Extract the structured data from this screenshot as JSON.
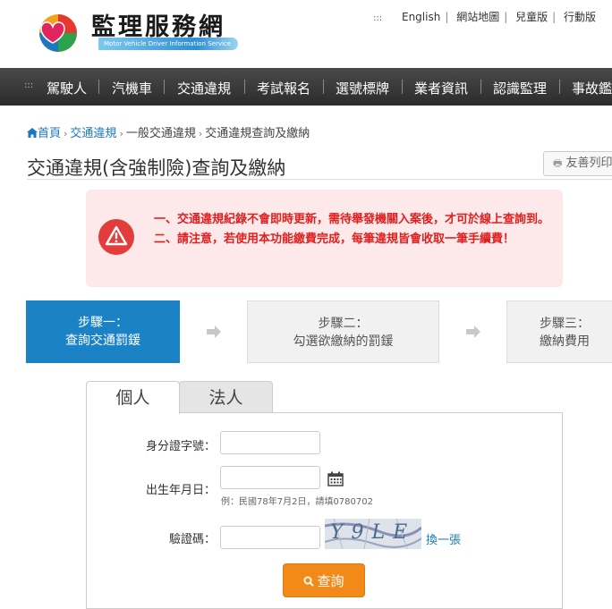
{
  "header": {
    "site_title": "監理服務網",
    "site_subtitle": "Motor Vehicle Driver Information Service",
    "top_links": [
      "English",
      "網站地圖",
      "兒童版",
      "行動版"
    ]
  },
  "nav": {
    "items": [
      "駕駛人",
      "汽機車",
      "交通違規",
      "考試報名",
      "選號標牌",
      "業者資訊",
      "認識監理",
      "事故鑑"
    ]
  },
  "breadcrumb": {
    "home": "首頁",
    "items": [
      "交通違規",
      "一般交通違規",
      "交通違規查詢及繳納"
    ]
  },
  "page": {
    "title": "交通違規(含強制險)查詢及繳納",
    "print_label": "友善列印"
  },
  "notice": {
    "line1": "一、交通違規紀錄不會即時更新，需待舉發機關入案後，才可於線上查詢到。",
    "line2": "二、請注意，若使用本功能繳費完成，每筆違規皆會收取一筆手續費！"
  },
  "steps": [
    {
      "title": "步驟一：",
      "desc": "查詢交通罰鍰"
    },
    {
      "title": "步驟二：",
      "desc": "勾選欲繳納的罰鍰"
    },
    {
      "title": "步驟三：",
      "desc": "繳納費用"
    }
  ],
  "tabs": {
    "personal": "個人",
    "corporate": "法人"
  },
  "form": {
    "id_label": "身分證字號：",
    "id_value": "",
    "birth_label": "出生年月日：",
    "birth_value": "",
    "birth_hint": "例：民國78年7月2日，請填0780702",
    "captcha_label": "驗證碼：",
    "captcha_value": "",
    "captcha_text": "Y9LE",
    "refresh_label": "換一張",
    "search_label": "查詢"
  },
  "colors": {
    "primary_blue": "#1b82c6",
    "alert_red": "#e02020",
    "search_orange": "#f28a1a",
    "nav_bg": "#333333"
  }
}
